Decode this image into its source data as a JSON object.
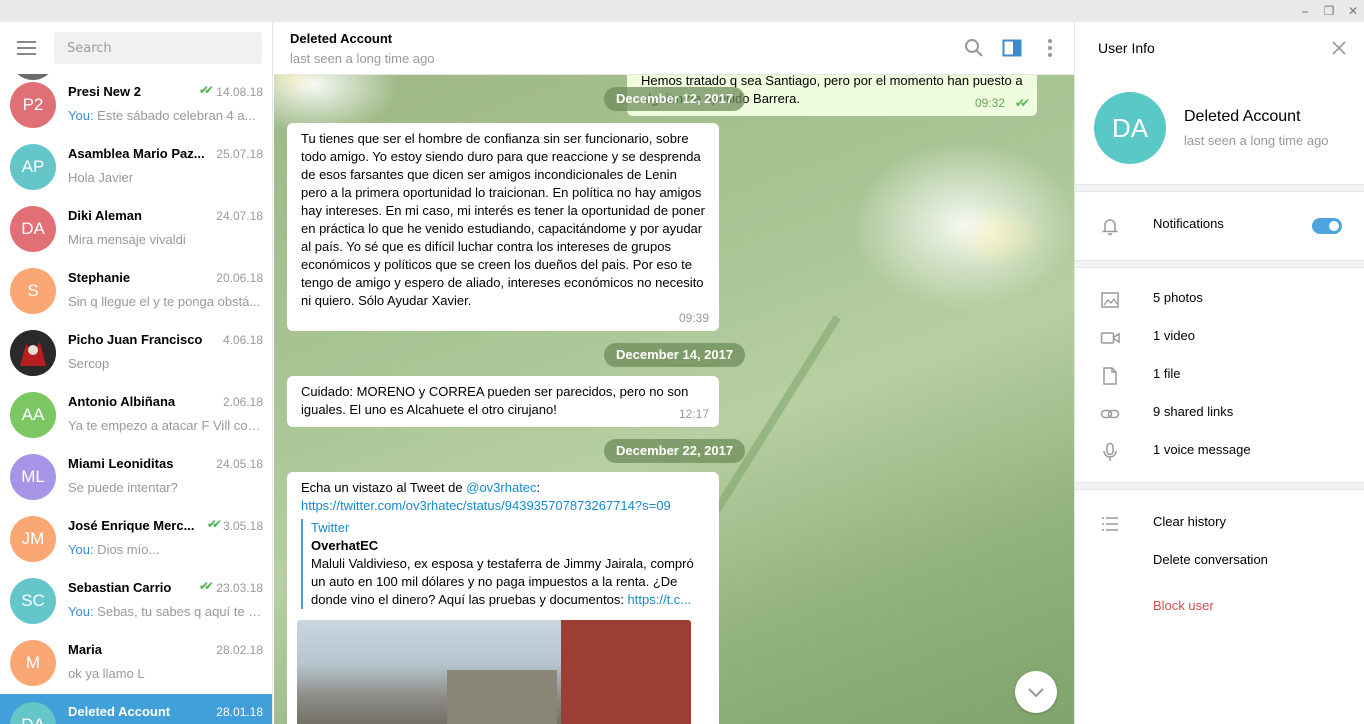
{
  "window": {
    "minimize": "⎯",
    "restore": "❐",
    "close": "✕"
  },
  "sidebar": {
    "search_placeholder": "Search",
    "chats": [
      {
        "initials": "P2",
        "color": "#e17076",
        "name": "Presi New 2",
        "date": "14.08.18",
        "read": true,
        "you": "You:",
        "preview": " Este sábado celebran 4 a..."
      },
      {
        "initials": "AP",
        "color": "#65c6c9",
        "name": "Asamblea Mario Paz...",
        "date": "25.07.18",
        "read": false,
        "you": "",
        "preview": "Hola Javier"
      },
      {
        "initials": "DA",
        "color": "#e17076",
        "name": "Diki Aleman",
        "date": "24.07.18",
        "read": false,
        "you": "",
        "preview": "Mira mensaje vivaldi"
      },
      {
        "initials": "S",
        "color": "#faa774",
        "name": "Stephanie",
        "date": "20.06.18",
        "read": false,
        "you": "",
        "preview": "Sin q llegue el y te ponga obstá..."
      },
      {
        "initials": "",
        "color": "#3b3b3b",
        "name": "Picho Juan Francisco",
        "date": "4.06.18",
        "read": false,
        "you": "",
        "preview": "Sercop"
      },
      {
        "initials": "AA",
        "color": "#7bc862",
        "name": "Antonio Albiñana",
        "date": "2.06.18",
        "read": false,
        "you": "",
        "preview": "Ya te empezo a atacar F Vill con..."
      },
      {
        "initials": "ML",
        "color": "#a695e7",
        "name": "Miami Leoniditas",
        "date": "24.05.18",
        "read": false,
        "you": "",
        "preview": "Se puede intentar?"
      },
      {
        "initials": "JM",
        "color": "#faa774",
        "name": "José Enrique Merc...",
        "date": "3.05.18",
        "read": true,
        "you": "You:",
        "preview": " Dios mío..."
      },
      {
        "initials": "SC",
        "color": "#65c6c9",
        "name": "Sebastian Carrio",
        "date": "23.03.18",
        "read": true,
        "you": "You:",
        "preview": " Sebas, tu sabes q aquí te q..."
      },
      {
        "initials": "M",
        "color": "#faa774",
        "name": "Maria",
        "date": "28.02.18",
        "read": false,
        "you": "",
        "preview": "ok ya llamo L"
      },
      {
        "initials": "DA",
        "color": "#65c6c9",
        "name": "Deleted Account",
        "date": "28.01.18",
        "read": false,
        "you": "",
        "preview": ""
      }
    ]
  },
  "chat": {
    "title": "Deleted Account",
    "status": "last seen a long time ago",
    "messages": {
      "m0_text": "Hemos tratado q sea Santiago, pero por el momento han puesto a alguien de apellido Barrera.",
      "m0_time": "09:32",
      "date1": "December 12, 2017",
      "m1_text": "Tu tienes que ser el hombre de confianza sin ser funcionario, sobre todo amigo. Yo estoy siendo duro para que reaccione y se desprenda de esos farsantes que dicen ser amigos incondicionales de Lenin pero a la primera oportunidad lo traicionan.  En política no hay amigos hay intereses. En mi caso, mi interés es tener la oportunidad de poner en práctica lo que he venido estudiando, capacitándome y por ayudar al país.  Yo sé que es difícil luchar contra los intereses de grupos económicos y políticos que se creen los dueños del pais. Por eso te tengo de amigo y espero de aliado, intereses económicos no necesito ni quiero. Sólo Ayudar Xavier.",
      "m1_time": "09:39",
      "date2": "December 14, 2017",
      "m2_text": "Cuidado: MORENO y CORREA pueden ser parecidos, pero no son iguales. El uno es Alcahuete el otro cirujano!",
      "m2_time": "12:17",
      "date3": "December 22, 2017",
      "m3_prefix": "Echa un vistazo al Tweet de ",
      "m3_mention": "@ov3rhatec",
      "m3_colon": ":",
      "m3_url": "https://twitter.com/ov3rhatec/status/943935707873267714?s=09",
      "m3_site": "Twitter",
      "m3_title": "OverhatEC",
      "m3_desc": "Maluli Valdivieso, ex esposa y testaferra de Jimmy Jairala, compró un auto en 100 mil dólares y no paga impuestos a la renta. ¿De donde vino el dinero? Aquí las pruebas y documentos: ",
      "m3_desc_link": "https://t.c..."
    }
  },
  "info": {
    "title": "User Info",
    "initials": "DA",
    "name": "Deleted Account",
    "status": "last seen a long time ago",
    "notifications_label": "Notifications",
    "notifications_on": true,
    "media": [
      "5 photos",
      "1 video",
      "1 file",
      "9 shared links",
      "1 voice message"
    ],
    "clear_history": "Clear history",
    "delete_conversation": "Delete conversation",
    "block_user": "Block user"
  }
}
